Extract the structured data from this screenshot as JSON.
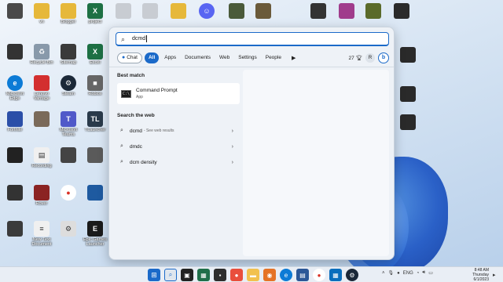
{
  "desktop": {
    "icons": [
      {
        "label": "",
        "x_hint": "col0",
        "color": "#4a4a4a"
      },
      {
        "label": "vn",
        "color": "#e6b83a"
      },
      {
        "label": "Blogger",
        "color": "#e6b83a"
      },
      {
        "label": "project",
        "color": "#1d7044"
      },
      {
        "label": "",
        "color": "#b0b0b0"
      },
      {
        "label": "",
        "color": "#b0b0b0"
      },
      {
        "label": "",
        "color": "#e6b83a"
      },
      {
        "label": "",
        "color": "#5865f2"
      },
      {
        "label": "Recycle Bin",
        "color": "#8899aa"
      },
      {
        "label": "Sitemap",
        "color": "#3a3a3a"
      },
      {
        "label": "Excel",
        "color": "#1d7044"
      },
      {
        "label": "Microsoft Edge",
        "color": "#0c7bd6"
      },
      {
        "label": "Lenovo Vantage",
        "color": "#d32f2f"
      },
      {
        "label": "Steam",
        "color": "#1b2838"
      },
      {
        "label": "Roblox",
        "color": "#666666"
      },
      {
        "label": "Fortnite",
        "color": "#2b4fa8"
      },
      {
        "label": "Microsoft Teams",
        "color": "#5059c9"
      },
      {
        "label": "TLauncher",
        "color": "#2a3a4a"
      },
      {
        "label": "Recording",
        "color": "#e8e8e8"
      },
      {
        "label": "Rover",
        "color": "#8b2323"
      },
      {
        "label": "Google Chrome",
        "color": "#e8e8e8"
      },
      {
        "label": "Epic Games Launcher",
        "color": "#1a1a1a"
      },
      {
        "label": "New Text Document",
        "color": "#f0f0f0"
      }
    ]
  },
  "search": {
    "query": "dcmd",
    "filters": [
      "Chat",
      "All",
      "Apps",
      "Documents",
      "Web",
      "Settings",
      "People"
    ],
    "active_filter": "All",
    "points": "27",
    "avatar_initial": "R",
    "bing_label": "b"
  },
  "results": {
    "best_match_heading": "Best match",
    "best_match": {
      "title": "Command Prompt",
      "subtitle": "App",
      "icon_text": "C:\\"
    },
    "web_heading": "Search the web",
    "web": [
      {
        "text": "dcmd",
        "sub": "- See web results"
      },
      {
        "text": "dmdc",
        "sub": ""
      },
      {
        "text": "dcm density",
        "sub": ""
      }
    ]
  },
  "taskbar": {
    "tray_lang": "ENG",
    "time": "8:48 AM",
    "day": "Thursday",
    "date": "6/1/2023"
  }
}
